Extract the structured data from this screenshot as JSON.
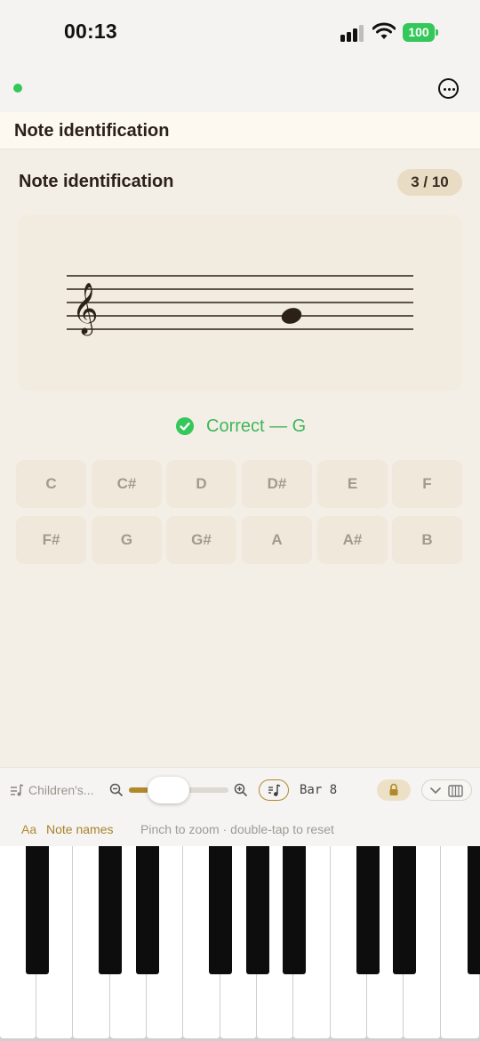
{
  "status_bar": {
    "time": "00:13",
    "battery": "100"
  },
  "nav": {
    "more_icon": "ellipsis-circle-icon",
    "online_indicator": "green-dot"
  },
  "header": {
    "title": "Note identification"
  },
  "exercise": {
    "title": "Note identification",
    "progress": "3 / 10",
    "clef": "treble",
    "feedback": "Correct — G"
  },
  "note_buttons": [
    "C",
    "C#",
    "D",
    "D#",
    "E",
    "F",
    "F#",
    "G",
    "G#",
    "A",
    "A#",
    "B"
  ],
  "toolbar": {
    "song_name": "Children's...",
    "zoom_level": 0.2,
    "bar_label": "Bar 8",
    "icons": [
      "song-list-icon",
      "zoom-out-icon",
      "zoom-in-icon",
      "music-note-icon",
      "lock-icon",
      "chevron-down-icon",
      "piano-keys-icon"
    ]
  },
  "label_row": {
    "font_label": "Aa",
    "note_names": "Note names",
    "hint": "Pinch to zoom · double-tap to reset"
  },
  "colors": {
    "accent": "#b08a2a",
    "success": "#34c759",
    "background": "#f4efe6",
    "ink": "#2b2118"
  }
}
